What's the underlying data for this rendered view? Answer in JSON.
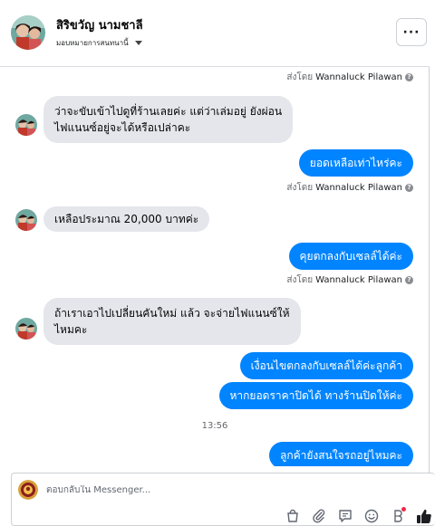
{
  "header": {
    "contact_name": "สิริขวัญ นามชาลี",
    "assign_label": "มอบหมายการสนทนานี้",
    "more_label": "···"
  },
  "messages": [
    {
      "type": "sent_by",
      "label": "ส่งโดย",
      "name": "Wannaluck Pilawan"
    },
    {
      "type": "in",
      "lines": [
        "ว่าจะขับเข้าไปดูที่ร้านเลยค่ะ แต่ว่าเล่มอยู่  ยังผ่อน",
        "ไฟแนนซ์อยู่จะได้หรือเปล่าคะ"
      ]
    },
    {
      "type": "out",
      "text": "ยอดเหลือเท่าไหร่คะ"
    },
    {
      "type": "sent_by",
      "label": "ส่งโดย",
      "name": "Wannaluck Pilawan"
    },
    {
      "type": "in",
      "lines": [
        "เหลือประมาณ 20,000 บาทค่ะ"
      ]
    },
    {
      "type": "out",
      "text": "คุยตกลงกับเซลล์ได้ค่ะ"
    },
    {
      "type": "sent_by",
      "label": "ส่งโดย",
      "name": "Wannaluck Pilawan"
    },
    {
      "type": "in",
      "lines": [
        "ถ้าเราเอาไปเปลี่ยนคันใหม่ แล้ว จะจ่ายไฟแนนซ์ให้",
        "ไหมคะ"
      ]
    },
    {
      "type": "out",
      "text": "เงื่อนไขตกลงกับเซลล์ได้ค่ะลูกค้า"
    },
    {
      "type": "out",
      "text": "หากยอดราคาปิดได้  ทางร้านปิดให้ค่ะ"
    },
    {
      "type": "time",
      "text": "13:56"
    },
    {
      "type": "out",
      "text": "ลูกค้ายังสนใจรถอยู่ไหมคะ"
    }
  ],
  "composer": {
    "placeholder": "ตอบกลับใน Messenger...",
    "icons": [
      "bag-icon",
      "paperclip-icon",
      "chat-template-icon",
      "emoji-icon",
      "bitmoji-icon",
      "thumbs-up-icon"
    ]
  },
  "colors": {
    "outgoing_bubble": "#0084ff",
    "incoming_bubble": "#e4e6eb",
    "notification_dot": "#f02849"
  }
}
